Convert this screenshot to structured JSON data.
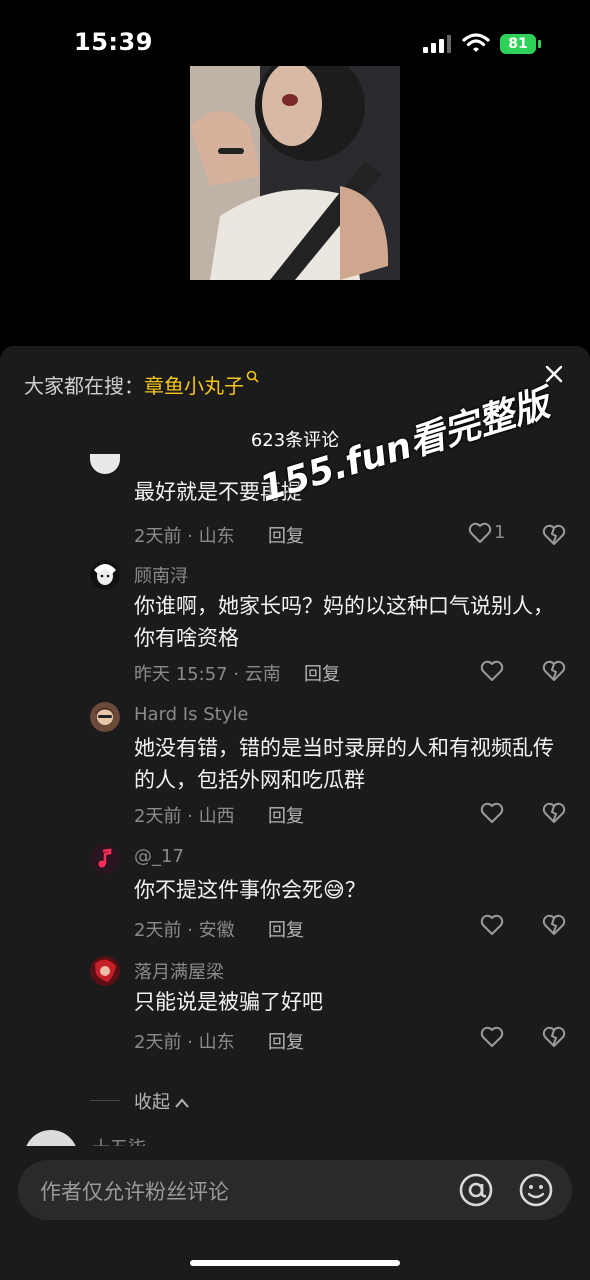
{
  "status": {
    "time": "15:39",
    "battery": "81"
  },
  "sheet": {
    "search_prefix": "大家都在搜：",
    "search_keyword": "章鱼小丸子",
    "comment_count": "623条评论"
  },
  "comments": [
    {
      "username": "",
      "text": "最好就是不要再提",
      "meta": "2天前 · 山东",
      "reply": "回复",
      "likes": "1"
    },
    {
      "username": "顾南浔",
      "text": "你谁啊，她家长吗？妈的以这种口气说别人，你有啥资格",
      "meta": "昨天 15:57 · 云南",
      "reply": "回复",
      "likes": ""
    },
    {
      "username": "Hard Is Style",
      "text": "她没有错，错的是当时录屏的人和有视频乱传的人，包括外网和吃瓜群",
      "meta": "2天前 · 山西",
      "reply": "回复",
      "likes": ""
    },
    {
      "username": "@_17",
      "text": "你不提这件事你会死😅？",
      "meta": "2天前 · 安徽",
      "reply": "回复",
      "likes": ""
    },
    {
      "username": "落月满屋梁",
      "text": "只能说是被骗了好吧",
      "meta": "2天前 · 山东",
      "reply": "回复",
      "likes": ""
    }
  ],
  "collapse_label": "收起",
  "next_comment_name": "十五柒",
  "input": {
    "placeholder": "作者仅允许粉丝评论"
  },
  "watermark": "155.fun看完整版",
  "colors": {
    "accent": "#f5c518",
    "sheet_bg": "#1b1b1b",
    "battery": "#30d158"
  },
  "icons": [
    "signal-icon",
    "wifi-icon",
    "close-icon",
    "heart-icon",
    "broken-heart-icon",
    "at-icon",
    "emoji-icon",
    "chevron-up-icon"
  ]
}
